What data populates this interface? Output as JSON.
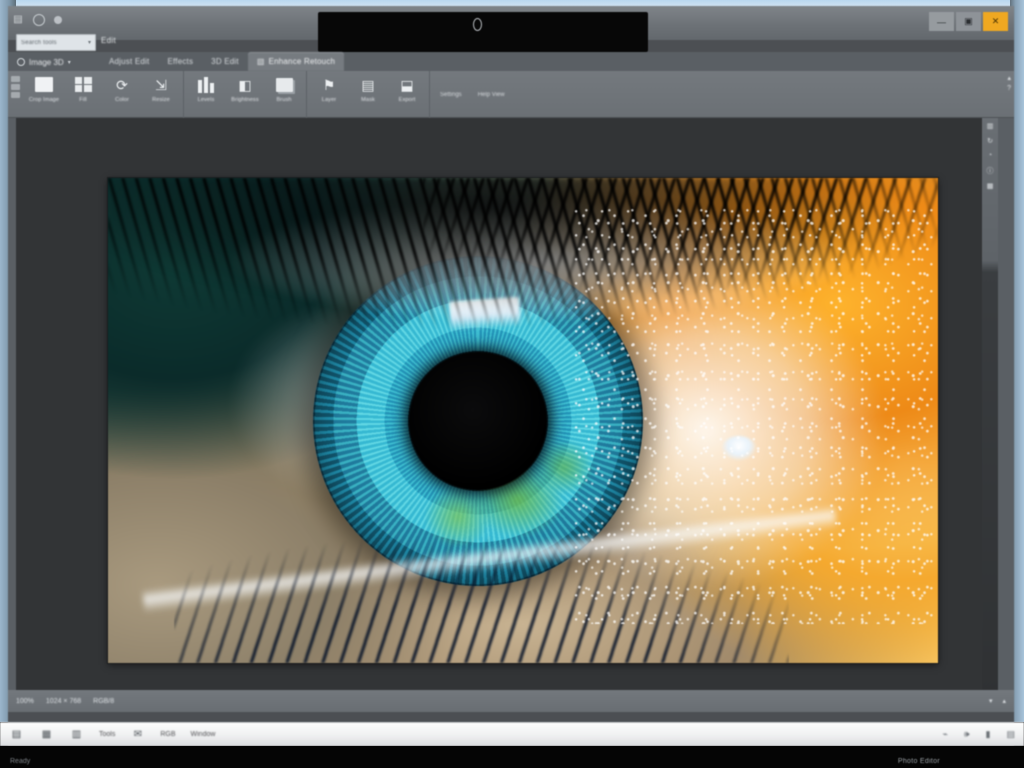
{
  "window": {
    "title_icons": [
      "app-menu-icon",
      "save-icon",
      "undo-icon"
    ],
    "controls": {
      "minimize": "—",
      "maximize": "▣",
      "close": "✕"
    },
    "accent_close_color": "#f0a81e"
  },
  "quick_access": {
    "search_placeholder": "Search tools",
    "search_caret": "▾",
    "label": "Edit"
  },
  "ribbon": {
    "file_tab": {
      "label": "Image 3D",
      "arrow": "▾"
    },
    "tabs": [
      {
        "label": "Adjust Edit",
        "active": false
      },
      {
        "label": "Effects",
        "active": false
      },
      {
        "label": "3D Edit",
        "active": false
      },
      {
        "label": "Enhance Retouch",
        "active": true
      }
    ],
    "groups": [
      {
        "name": "clipboard-group",
        "buttons": [
          {
            "icon": "crop-icon",
            "label": "Crop Image"
          },
          {
            "icon": "grid-icon",
            "label": "Fill"
          },
          {
            "icon": "rotate-icon",
            "label": "Color"
          },
          {
            "icon": "resize-icon",
            "label": "Resize"
          }
        ]
      },
      {
        "name": "adjust-group",
        "buttons": [
          {
            "icon": "levels-icon",
            "label": "Levels"
          },
          {
            "icon": "contrast-icon",
            "label": "Brightness"
          },
          {
            "icon": "brush-icon",
            "label": "Brush"
          }
        ]
      },
      {
        "name": "layers-group",
        "buttons": [
          {
            "icon": "layer-icon",
            "label": "Layer"
          },
          {
            "icon": "mask-icon",
            "label": "Mask"
          },
          {
            "icon": "export-icon",
            "label": "Export"
          }
        ]
      }
    ],
    "tail_labels": [
      "Settings",
      "Help View"
    ],
    "right_icons": [
      "collapse-icon",
      "help-icon"
    ]
  },
  "panel_rail": {
    "icons": [
      "layers-panel-icon",
      "history-panel-icon",
      "adjust-panel-icon",
      "info-panel-icon",
      "color-panel-icon"
    ]
  },
  "canvas": {
    "background_color": "#323436",
    "image": {
      "name": "macro-eye-photograph",
      "description": "Extreme close-up macro photograph of a human eye with a cyan-teal iris, golden sunburst corona around the black pupil and an orange limbal ring, surrounded by dark eyelashes and warm orange glittering skin.",
      "colors": {
        "iris_cyan": "#49c6da",
        "iris_teal_deep": "#0c4256",
        "corona_gold": "#f6b51c",
        "limbal_orange": "#e8960f",
        "skin_orange": "#f08a14",
        "skin_highlight": "#ffd87a",
        "lash_black": "#060606",
        "sclera_white": "#fafafc",
        "iris_green_fleck": "#6cba4a"
      }
    }
  },
  "status_bar": {
    "items": [
      "100%",
      "1024 × 768",
      "RGB/8"
    ],
    "right_icons": [
      "zoom-out-icon",
      "zoom-in-icon"
    ]
  },
  "taskbar": {
    "icons": [
      "start-icon",
      "files-icon",
      "store-icon",
      "mail-icon",
      "folder-icon"
    ],
    "labels": [
      "Tools",
      "RGB",
      "Window"
    ],
    "right_icons": [
      "network-icon",
      "sound-icon",
      "battery-icon",
      "notifications-icon"
    ]
  },
  "bottom_caption": {
    "right": "Photo Editor",
    "left": "Ready"
  }
}
